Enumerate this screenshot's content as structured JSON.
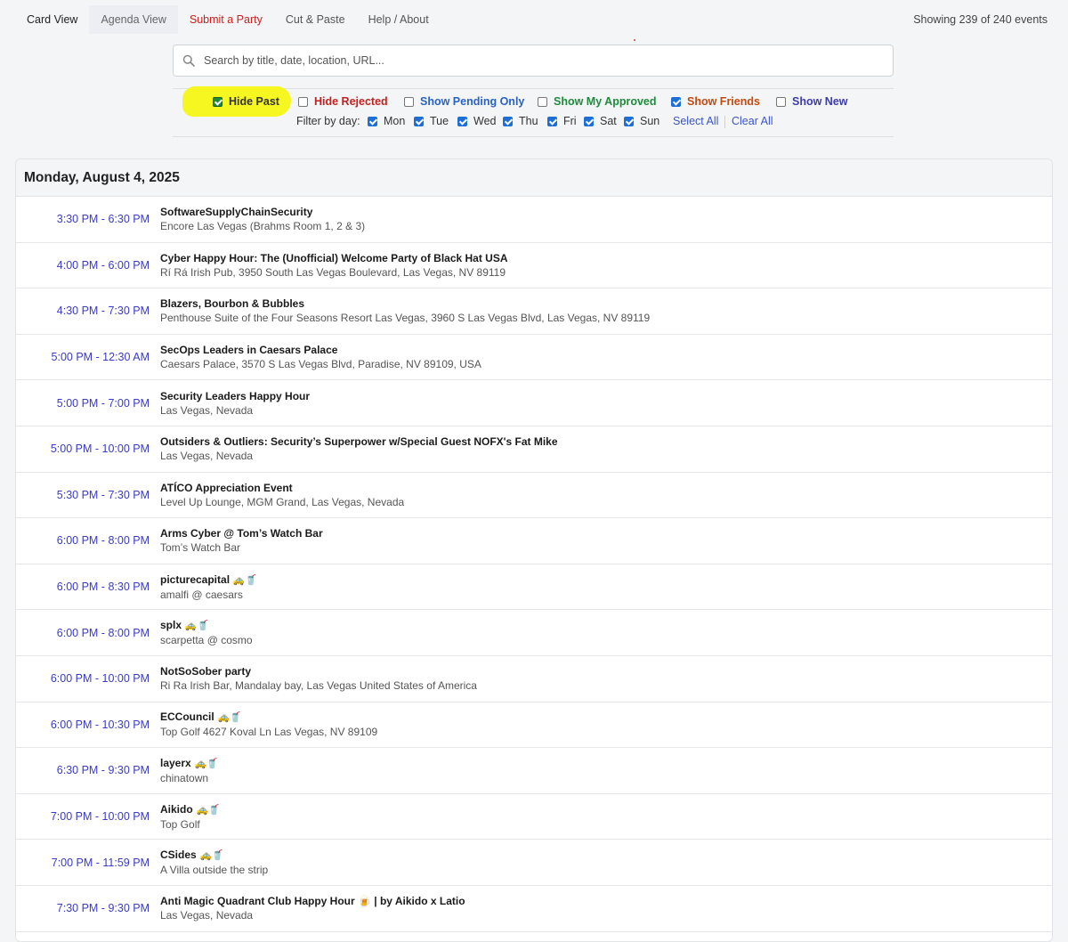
{
  "nav": {
    "tabs": [
      {
        "label": "Card View"
      },
      {
        "label": "Agenda View"
      },
      {
        "label": "Submit a Party"
      },
      {
        "label": "Cut & Paste"
      },
      {
        "label": "Help / About"
      }
    ],
    "showing": "Showing 239 of 240 events"
  },
  "search": {
    "placeholder": "Search by title, date, location, URL..."
  },
  "filters": {
    "hide_past": {
      "label": "Hide Past",
      "checked": true,
      "color": "#333333"
    },
    "hide_rejected": {
      "label": "Hide Rejected",
      "checked": false,
      "color": "#c0221f"
    },
    "show_pending": {
      "label": "Show Pending Only",
      "checked": false,
      "color": "#2a62c4"
    },
    "show_approved": {
      "label": "Show My Approved",
      "checked": false,
      "color": "#1f8a3b"
    },
    "show_friends": {
      "label": "Show Friends",
      "checked": true,
      "color": "#c04a10"
    },
    "show_new": {
      "label": "Show New",
      "checked": false,
      "color": "#3c3ca8"
    },
    "day_label": "Filter by day:",
    "days": [
      "Mon",
      "Tue",
      "Wed",
      "Thu",
      "Fri",
      "Sat",
      "Sun"
    ],
    "select_all": "Select All",
    "clear_all": "Clear All"
  },
  "agenda": {
    "date": "Monday, August 4, 2025",
    "events": [
      {
        "time": "3:30 PM - 6:30 PM",
        "title": "SoftwareSupplyChainSecurity",
        "location": "Encore Las Vegas (Brahms Room 1, 2 & 3)"
      },
      {
        "time": "4:00 PM - 6:00 PM",
        "title": "Cyber Happy Hour: The (Unofficial) Welcome Party of Black Hat USA",
        "location": "Rí Rá Irish Pub, 3950 South Las Vegas Boulevard, Las Vegas, NV 89119"
      },
      {
        "time": "4:30 PM - 7:30 PM",
        "title": "Blazers, Bourbon & Bubbles",
        "location": "Penthouse Suite of the Four Seasons Resort Las Vegas, 3960 S Las Vegas Blvd, Las Vegas, NV 89119"
      },
      {
        "time": "5:00 PM - 12:30 AM",
        "title": "SecOps Leaders in Caesars Palace",
        "location": "Caesars Palace, 3570 S Las Vegas Blvd, Paradise, NV 89109, USA"
      },
      {
        "time": "5:00 PM - 7:00 PM",
        "title": "Security Leaders Happy Hour",
        "location": "Las Vegas, Nevada"
      },
      {
        "time": "5:00 PM - 10:00 PM",
        "title": "Outsiders & Outliers: Security’s Superpower w/Special Guest NOFX's Fat Mike",
        "location": "Las Vegas, Nevada"
      },
      {
        "time": "5:30 PM - 7:30 PM",
        "title": "ATÍCO Appreciation Event",
        "location": "Level Up Lounge, MGM Grand, Las Vegas, Nevada"
      },
      {
        "time": "6:00 PM - 8:00 PM",
        "title": "Arms Cyber @ Tom’s Watch Bar",
        "location": "Tom’s Watch Bar"
      },
      {
        "time": "6:00 PM - 8:30 PM",
        "title": "picturecapital",
        "emoji": "🚕🥤",
        "location": "amalfi @ caesars"
      },
      {
        "time": "6:00 PM - 8:00 PM",
        "title": "splx",
        "emoji": "🚕🥤",
        "location": "scarpetta @ cosmo"
      },
      {
        "time": "6:00 PM - 10:00 PM",
        "title": "NotSoSober party",
        "location": "Ri Ra Irish Bar, Mandalay bay, Las Vegas United States of America"
      },
      {
        "time": "6:00 PM - 10:30 PM",
        "title": "ECCouncil",
        "emoji": "🚕🥤",
        "location": "Top Golf 4627 Koval Ln Las Vegas, NV 89109"
      },
      {
        "time": "6:30 PM - 9:30 PM",
        "title": "layerx",
        "emoji": "🚕🥤",
        "location": "chinatown"
      },
      {
        "time": "7:00 PM - 10:00 PM",
        "title": "Aikido",
        "emoji": "🚕🥤",
        "location": "Top Golf"
      },
      {
        "time": "7:00 PM - 11:59 PM",
        "title": "CSides",
        "emoji": "🚕🥤",
        "location": "A Villa outside the strip"
      },
      {
        "time": "7:30 PM - 9:30 PM",
        "title": "Anti Magic Quadrant Club Happy Hour 🍺 | by Aikido x Latio",
        "location": "Las Vegas, Nevada"
      }
    ]
  }
}
